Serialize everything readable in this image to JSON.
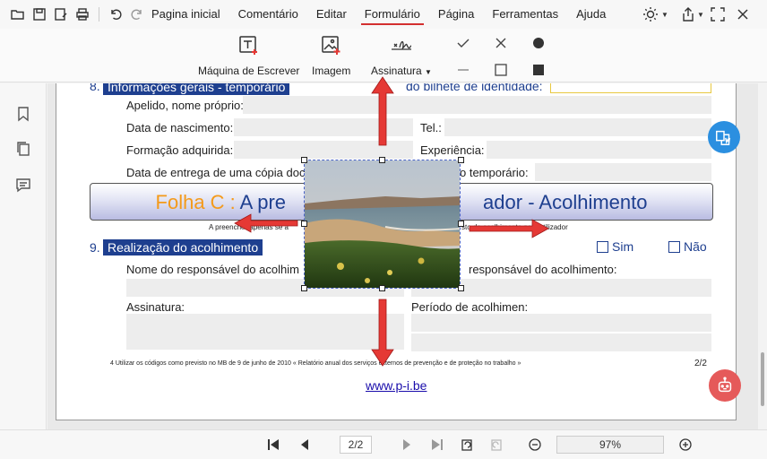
{
  "menubar": {
    "items": [
      "Pagina inicial",
      "Comentário",
      "Editar",
      "Formulário",
      "Página",
      "Ferramentas",
      "Ajuda"
    ],
    "active": "Formulário"
  },
  "ribbon": {
    "typewriter": "Máquina de Escrever",
    "image": "Imagem",
    "signature": "Assinatura"
  },
  "document": {
    "section8_title": "Informações gerais - temporário",
    "section8_partial": "do bilhete de identidade:",
    "apelido": "Apelido, nome próprio:",
    "nascimento": "Data de nascimento:",
    "tel": "Tel.:",
    "formacao": "Formação adquirida:",
    "experiencia": "Experiência:",
    "entrega_left": "Data de entrega de uma cópia doc",
    "entrega_right": "o temporário:",
    "banner_orange": "Folha C : ",
    "banner_left": "A pre",
    "banner_right": "ador - Acolhimento",
    "banner_note_left": "A preencher apenas se a",
    "banner_note_right": "sto de acolhimento pelo utilizador",
    "section9_num": "9.",
    "section9_title": "Realização do acolhimento",
    "sim": "Sim",
    "nao": "Não",
    "responsavel_left": "Nome do responsável do acolhim",
    "responsavel_right": "responsável do acolhimento:",
    "assinatura": "Assinatura:",
    "periodo": "Período de acolhimen:",
    "footnote": "4 Utilizar os códigos como previsto no MB de 9 de junho de 2010 « Relatório anual dos serviços externos de prevenção e de proteção no trabalho »",
    "page_num": "2/2",
    "link": "www.p-i.be"
  },
  "bottombar": {
    "page": "2/2",
    "zoom": "97%"
  },
  "colors": {
    "accent": "#d32f2f",
    "doc_blue": "#1e3f8f",
    "banner_orange": "#f49a1a",
    "arrow_red": "#e53935",
    "fab_blue": "#2b8fe0",
    "fab_red": "#e55a5a"
  }
}
